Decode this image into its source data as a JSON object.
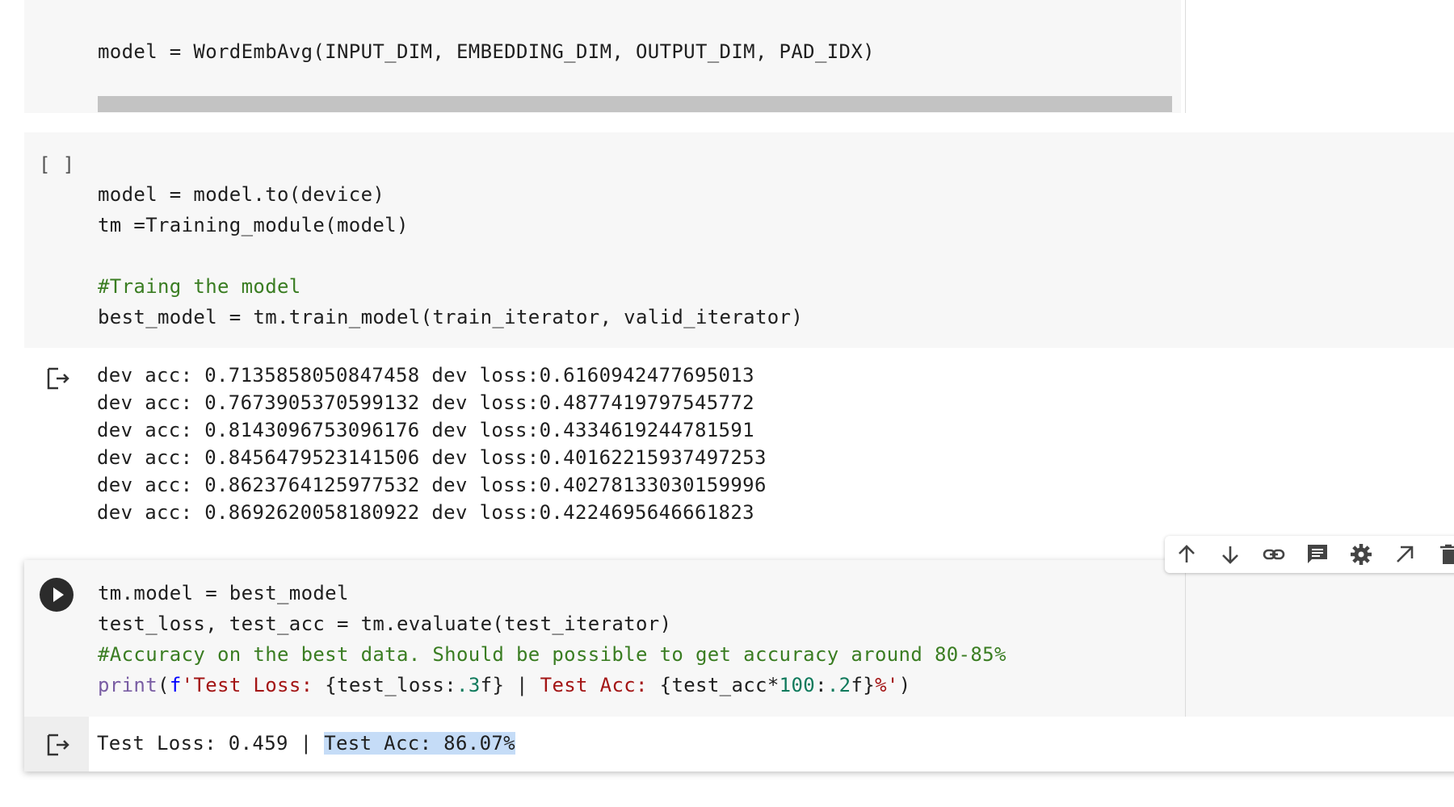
{
  "cell1": {
    "code": "model = WordEmbAvg(INPUT_DIM, EMBEDDING_DIM, OUTPUT_DIM, PAD_IDX)"
  },
  "cell2": {
    "exec_count": "[ ]",
    "lines": [
      "model = model.to(device)",
      "tm =Training_module(model)",
      "",
      "#Traing the model",
      "best_model = tm.train_model(train_iterator, valid_iterator)"
    ],
    "output": [
      "dev acc: 0.7135858050847458 dev loss:0.6160942477695013",
      "dev acc: 0.7673905370599132 dev loss:0.4877419797545772",
      "dev acc: 0.8143096753096176 dev loss:0.4334619244781591",
      "dev acc: 0.8456479523141506 dev loss:0.40162215937497253",
      "dev acc: 0.8623764125977532 dev loss:0.40278133030159996",
      "dev acc: 0.8692620058180922 dev loss:0.4224695646661823"
    ]
  },
  "cell3": {
    "line1": "tm.model = best_model",
    "line2": "test_loss, test_acc = tm.evaluate(test_iterator)",
    "line3": "#Accuracy on the best data. Should be possible to get accuracy around 80-85%",
    "line4": {
      "print": "print",
      "open": "(",
      "f": "f",
      "q1": "'",
      "s1": "Test Loss: ",
      "e1": "{test_loss:",
      "p1": ".3",
      "e1b": "f}",
      "sep": " | ",
      "s2": "Test Acc: ",
      "e2": "{test_acc*",
      "n100": "100",
      "e2b": ":",
      "p2": ".2",
      "e2c": "f}",
      "pct": "%",
      "q2": "'",
      "close": ")"
    },
    "output_plain": "Test Loss: 0.459 | ",
    "output_highlight": "Test Acc: 86.07%"
  },
  "toolbar": {
    "icons": [
      "arrow-up-icon",
      "arrow-down-icon",
      "link-icon",
      "comment-icon",
      "gear-icon",
      "open-in-editor-icon",
      "trash-icon"
    ]
  },
  "colors": {
    "cell_bg": "#f7f7f7",
    "comment": "#3a7d22",
    "string": "#a31515",
    "keyword": "#795da3",
    "number": "#0f7a5c",
    "highlight": "#c5dcf7"
  }
}
